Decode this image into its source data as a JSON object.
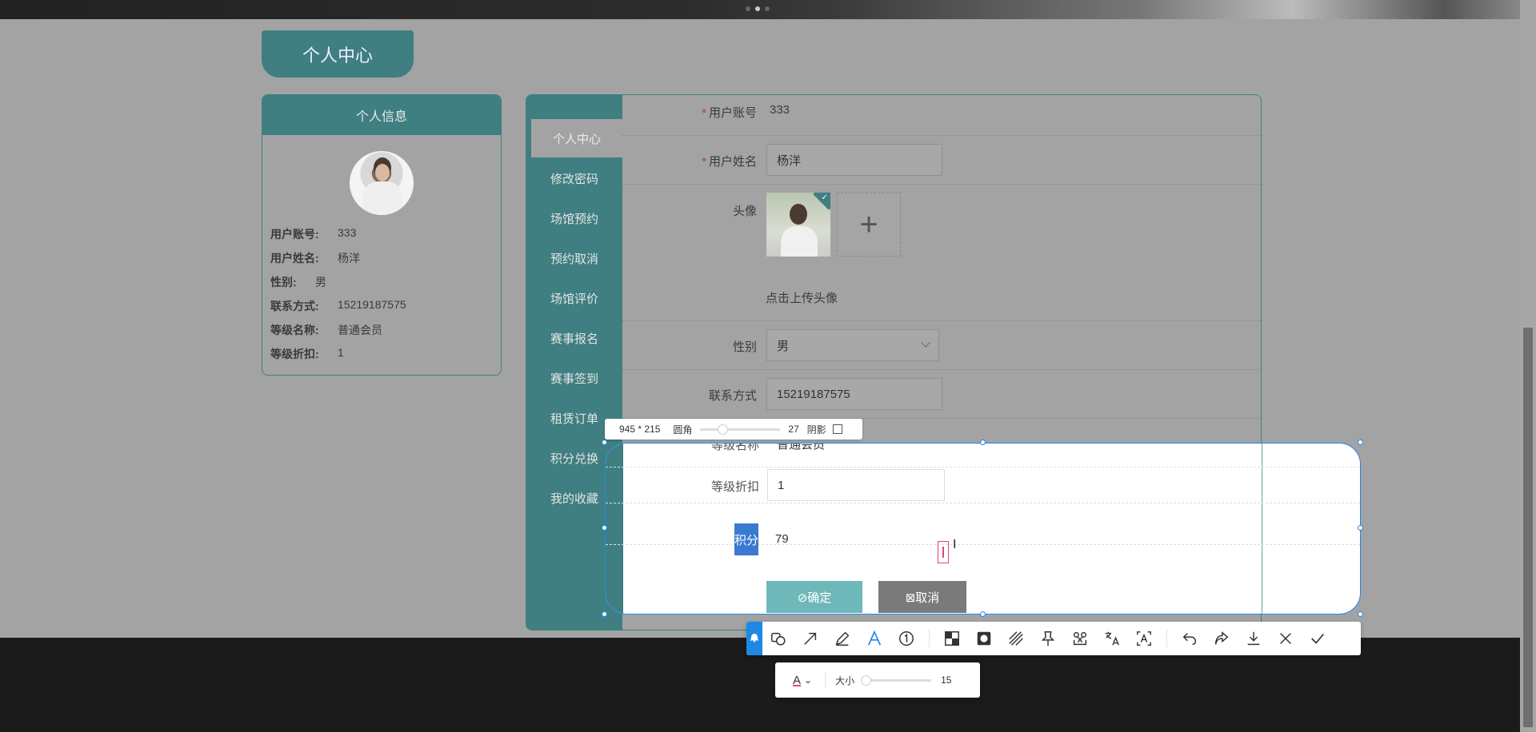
{
  "page": {
    "title_tab": "个人中心",
    "info_card_header": "个人信息",
    "info": [
      {
        "key": "用户账号:",
        "value": "333"
      },
      {
        "key": "用户姓名:",
        "value": "杨洋"
      },
      {
        "key": "性别:",
        "value": "男"
      },
      {
        "key": "联系方式:",
        "value": "15219187575"
      },
      {
        "key": "等级名称:",
        "value": "普通会员"
      },
      {
        "key": "等级折扣:",
        "value": "1"
      }
    ],
    "menu": [
      "个人中心",
      "修改密码",
      "场馆预约",
      "预约取消",
      "场馆评价",
      "赛事报名",
      "赛事签到",
      "租赁订单",
      "积分兑换",
      "我的收藏"
    ],
    "form": {
      "account_label": "用户账号",
      "account_value": "333",
      "name_label": "用户姓名",
      "name_value": "杨洋",
      "avatar_label": "头像",
      "upload_hint": "点击上传头像",
      "gender_label": "性别",
      "gender_value": "男",
      "phone_label": "联系方式",
      "phone_value": "15219187575",
      "level_label": "等级名称",
      "level_value": "普通会员",
      "discount_label": "等级折扣",
      "discount_value": "1",
      "points_label": "积分",
      "points_value": "79",
      "confirm_label": "⊘确定",
      "cancel_label": "⊠取消"
    }
  },
  "capture_tool": {
    "size_text": "945 * 215",
    "radius_label": "圆角",
    "radius_value": "27",
    "shadow_label": "阴影",
    "shadow_checked": false,
    "toolbar_tools": [
      "shape-icon",
      "arrow-icon",
      "pen-icon",
      "text-icon",
      "number-icon",
      "mosaic-icon",
      "circle-fill-icon",
      "hatch-icon",
      "pin-icon",
      "ocr-icon",
      "translate-icon",
      "text-detect-icon",
      "undo-icon",
      "redo-icon",
      "download-icon",
      "close-icon",
      "check-icon"
    ],
    "active_tool": "text-icon",
    "text_opts": {
      "color_glyph": "A",
      "size_label": "大小",
      "size_value": "15",
      "color": "#e0457b"
    }
  }
}
